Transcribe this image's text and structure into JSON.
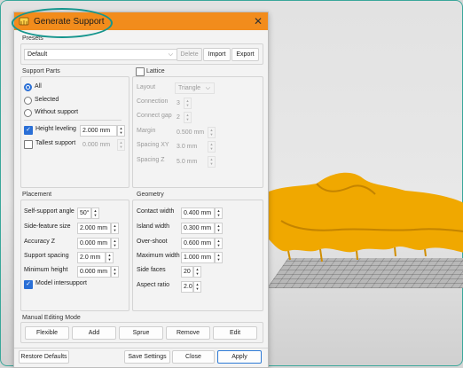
{
  "dialog": {
    "title": "Generate Support",
    "close_label": "✕"
  },
  "presets": {
    "title": "Presets",
    "selected": "Default",
    "delete_label": "Delete",
    "import_label": "Import",
    "export_label": "Export"
  },
  "support_parts": {
    "title": "Support Parts",
    "options": [
      "All",
      "Selected",
      "Without support"
    ],
    "selected_index": 0,
    "height_leveling": {
      "label": "Height leveling",
      "checked": true,
      "value": "2.000 mm"
    },
    "tallest_support": {
      "label": "Tallest support",
      "checked": false,
      "value": "0.000 mm"
    }
  },
  "lattice": {
    "title": "Lattice",
    "checked": false,
    "layout": {
      "label": "Layout",
      "value": "Triangle"
    },
    "connection": {
      "label": "Connection",
      "value": "3"
    },
    "connect_gap": {
      "label": "Connect gap",
      "value": "2"
    },
    "margin": {
      "label": "Margin",
      "value": "0.500 mm"
    },
    "spacing_xy": {
      "label": "Spacing XY",
      "value": "3.0 mm"
    },
    "spacing_z": {
      "label": "Spacing Z",
      "value": "5.0 mm"
    }
  },
  "placement": {
    "title": "Placement",
    "self_support_angle": {
      "label": "Self-support angle",
      "value": "50°"
    },
    "side_feature_size": {
      "label": "Side-feature size",
      "value": "2.000 mm"
    },
    "accuracy_z": {
      "label": "Accuracy Z",
      "value": "0.000 mm"
    },
    "support_spacing": {
      "label": "Support spacing",
      "value": "2.0 mm"
    },
    "minimum_height": {
      "label": "Minimum height",
      "value": "0.000 mm"
    },
    "model_intersupport": {
      "label": "Model intersupport",
      "checked": true
    }
  },
  "geometry": {
    "title": "Geometry",
    "contact_width": {
      "label": "Contact width",
      "value": "0.400 mm"
    },
    "island_width": {
      "label": "Island width",
      "value": "0.300 mm"
    },
    "over_shoot": {
      "label": "Over-shoot",
      "value": "0.600 mm"
    },
    "maximum_width": {
      "label": "Maximum width",
      "value": "1.000 mm"
    },
    "side_faces": {
      "label": "Side faces",
      "value": "20"
    },
    "aspect_ratio": {
      "label": "Aspect ratio",
      "value": "2.0"
    }
  },
  "manual_editing": {
    "title": "Manual Editing Mode",
    "buttons": [
      "Flexible",
      "Add",
      "Sprue",
      "Remove",
      "Edit"
    ]
  },
  "footer": {
    "restore_label": "Restore Defaults",
    "save_label": "Save Settings",
    "close_label": "Close",
    "apply_label": "Apply"
  },
  "colors": {
    "titlebar": "#f28c1c",
    "accent": "#2a6fd6",
    "model": "#f0a800",
    "highlight": "#15958d"
  },
  "icons": {
    "app": "support-app-icon",
    "spin": "spin-up-down-icon",
    "dropdown": "chevron-down-icon"
  }
}
